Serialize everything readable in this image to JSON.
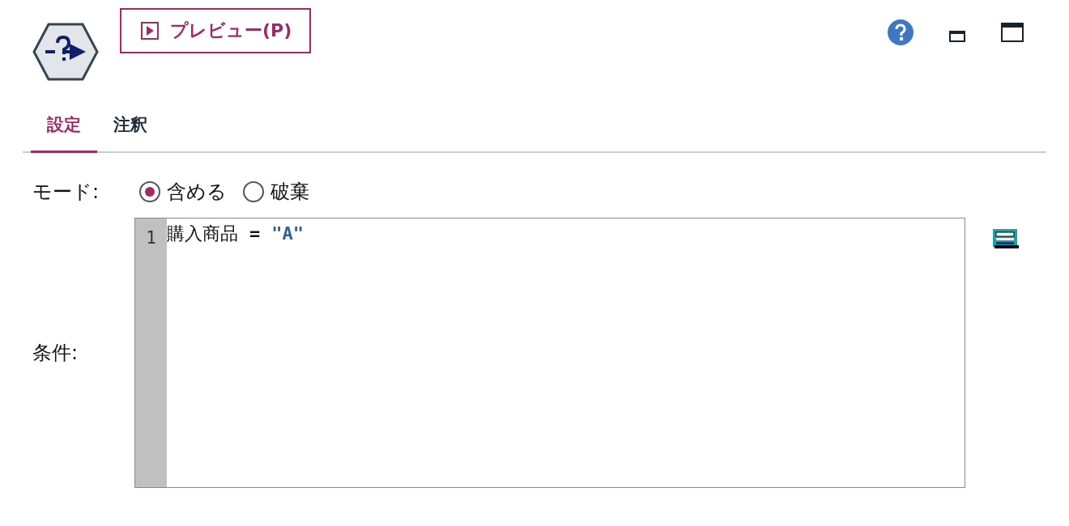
{
  "toolbar": {
    "preview_button": {
      "label": "プレビュー(P)"
    }
  },
  "tabs": [
    {
      "label": "設定",
      "selected": true
    },
    {
      "label": "注釈",
      "selected": false
    }
  ],
  "mode": {
    "label": "モード:",
    "options": [
      {
        "label": "含める",
        "selected": true
      },
      {
        "label": "破棄",
        "selected": false
      }
    ]
  },
  "condition": {
    "label": "条件:",
    "lines": [
      {
        "number": "1",
        "tokens": [
          {
            "kind": "field",
            "text": "購入商品"
          },
          {
            "kind": "operator",
            "text": "="
          },
          {
            "kind": "string",
            "text": "\"A\""
          }
        ]
      }
    ]
  }
}
